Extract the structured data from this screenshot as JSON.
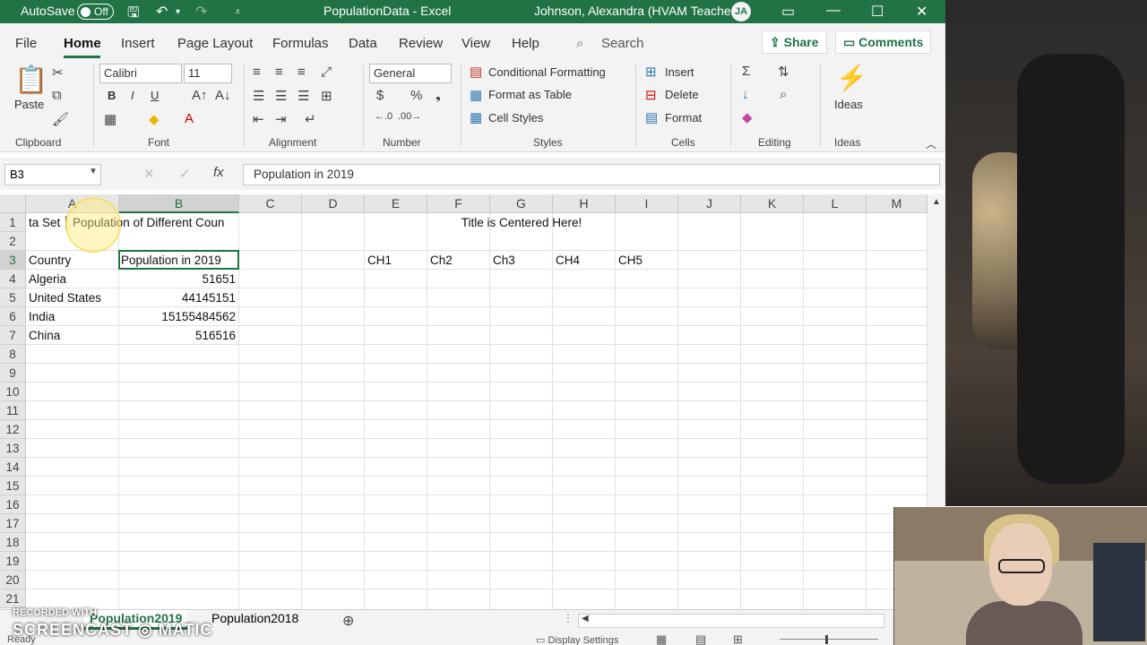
{
  "window": {
    "autosave_label": "AutoSave",
    "autosave_state": "Off",
    "title": "PopulationData  -  Excel",
    "user": "Johnson, Alexandra (HVAM Teacher)",
    "user_initials": "JA"
  },
  "tabs": [
    "File",
    "Home",
    "Insert",
    "Page Layout",
    "Formulas",
    "Data",
    "Review",
    "View",
    "Help"
  ],
  "search_label": "Search",
  "share_label": "Share",
  "comments_label": "Comments",
  "ribbon": {
    "paste_label": "Paste",
    "clipboard_label": "Clipboard",
    "font_name": "Calibri",
    "font_size": "11",
    "bold": "B",
    "italic": "I",
    "underline": "U",
    "font_label": "Font",
    "alignment_label": "Alignment",
    "number_format": "General",
    "number_label": "Number",
    "conditional_formatting": "Conditional Formatting",
    "format_as_table": "Format as Table",
    "cell_styles": "Cell Styles",
    "styles_label": "Styles",
    "insert": "Insert",
    "delete": "Delete",
    "format": "Format",
    "cells_label": "Cells",
    "editing_label": "Editing",
    "ideas": "Ideas",
    "ideas_group_label": "Ideas"
  },
  "formula_bar": {
    "name_box": "B3",
    "formula": "Population in 2019"
  },
  "columns": [
    "A",
    "B",
    "C",
    "D",
    "E",
    "F",
    "G",
    "H",
    "I",
    "J",
    "K",
    "L",
    "M"
  ],
  "rows": [
    "1",
    "2",
    "3",
    "4",
    "5",
    "6",
    "7",
    "8",
    "9",
    "10",
    "11",
    "12",
    "13",
    "14",
    "15",
    "16",
    "17",
    "18",
    "19",
    "20",
    "21"
  ],
  "cells": {
    "A1": "ta Set",
    "B1": "Population of Different Coun",
    "E1": "Title is Centered Here!",
    "A3": "Country",
    "B3": "Population in 2019",
    "E3": "CH1",
    "F3": "Ch2",
    "G3": "Ch3",
    "H3": "CH4",
    "I3": "CH5",
    "A4": "Algeria",
    "B4": "51651",
    "A5": "United States",
    "B5": "44145151",
    "A6": "India",
    "B6": "15155484562",
    "A7": "China",
    "B7": "516516"
  },
  "sheets": [
    "Population2019",
    "Population2018"
  ],
  "status": {
    "ready": "Ready",
    "display_settings": "Display Settings"
  },
  "watermark": {
    "line1": "RECORDED WITH",
    "line2": "SCREENCAST ◎ MATIC"
  }
}
